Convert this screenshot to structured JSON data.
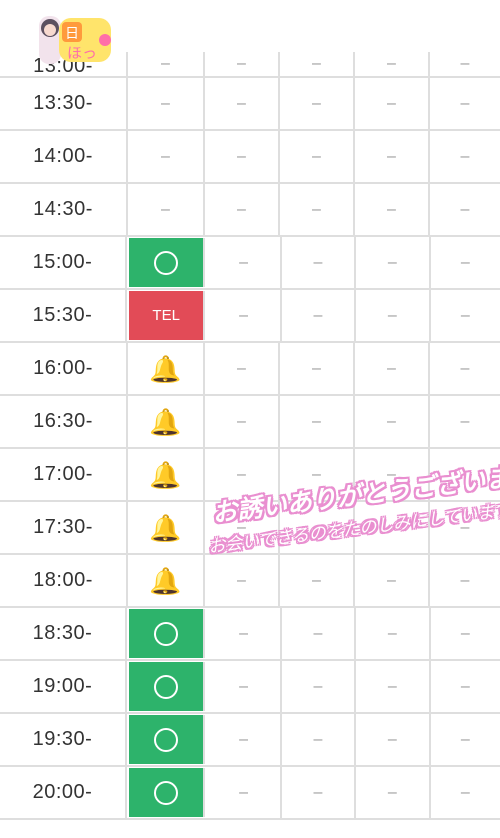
{
  "brand": {
    "logo_text": "ほっ"
  },
  "empty_mark": "–",
  "icons": {
    "available": "circle-icon",
    "call": "tel-label",
    "request": "bell-icon"
  },
  "colors": {
    "available": "#2db36b",
    "tel": "#e24b57",
    "bell": "#f5b400",
    "grid": "#dedede"
  },
  "rows": [
    {
      "time": "13:00-",
      "today": "–",
      "status": "empty"
    },
    {
      "time": "13:30-",
      "today": "–",
      "status": "empty"
    },
    {
      "time": "14:00-",
      "today": "–",
      "status": "empty"
    },
    {
      "time": "14:30-",
      "today": "–",
      "status": "empty"
    },
    {
      "time": "15:00-",
      "today": "",
      "status": "available"
    },
    {
      "time": "15:30-",
      "today": "TEL",
      "status": "tel"
    },
    {
      "time": "16:00-",
      "today": "",
      "status": "bell"
    },
    {
      "time": "16:30-",
      "today": "",
      "status": "bell"
    },
    {
      "time": "17:00-",
      "today": "",
      "status": "bell"
    },
    {
      "time": "17:30-",
      "today": "",
      "status": "bell"
    },
    {
      "time": "18:00-",
      "today": "",
      "status": "bell"
    },
    {
      "time": "18:30-",
      "today": "",
      "status": "available"
    },
    {
      "time": "19:00-",
      "today": "",
      "status": "available"
    },
    {
      "time": "19:30-",
      "today": "",
      "status": "available"
    },
    {
      "time": "20:00-",
      "today": "",
      "status": "available"
    }
  ],
  "watermark": {
    "line1": "お誘いありがとうございます♡",
    "line2": "お会いできるのをたのしみにしています☺"
  }
}
